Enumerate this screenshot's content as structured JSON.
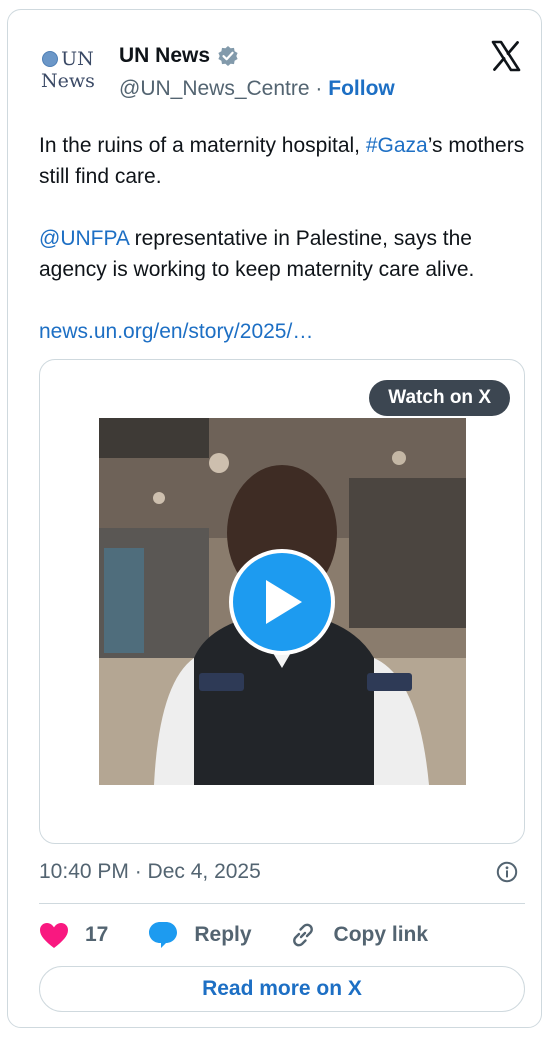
{
  "author": {
    "logo_text_top": "UN",
    "logo_text_bottom": "News",
    "name": "UN News",
    "handle": "@UN_News_Centre",
    "separator": "·",
    "follow_label": "Follow"
  },
  "post": {
    "line1_before": "In the ruins of a maternity hospital, ",
    "hashtag": "#Gaza",
    "line1_after": "’s mothers still find care.",
    "mention": "@UNFPA",
    "line2_after": " representative in Palestine, says the agency is working to keep maternity care alive.",
    "link": "news.un.org/en/story/2025/…"
  },
  "media": {
    "watch_label": "Watch on X"
  },
  "footer": {
    "timestamp": "10:40 PM · Dec 4, 2025",
    "like_count": "17",
    "reply_label": "Reply",
    "copy_label": "Copy link",
    "read_more_label": "Read more on X"
  },
  "colors": {
    "link": "#1d6fc4",
    "like": "#f91880",
    "reply_icon": "#1d9bf0",
    "play": "#1d9bf0",
    "verified": "#829aab"
  },
  "icons": [
    "un-emblem-icon",
    "verified-badge-icon",
    "x-logo-icon",
    "play-icon",
    "info-icon",
    "heart-icon",
    "reply-bubble-icon",
    "link-icon"
  ]
}
